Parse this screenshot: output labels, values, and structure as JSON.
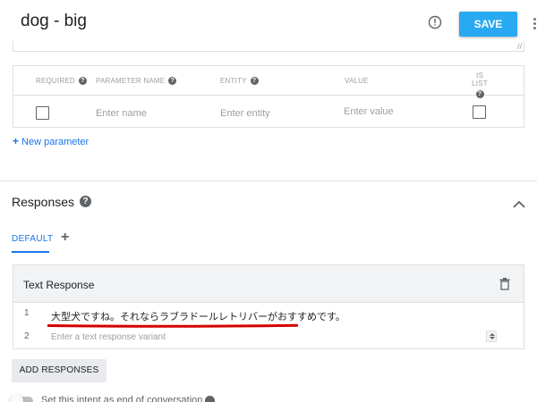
{
  "header": {
    "title": "dog - big",
    "save_label": "SAVE",
    "accent_color": "#29a9f2"
  },
  "parameters": {
    "columns": {
      "required": "REQUIRED",
      "parameter_name": "PARAMETER NAME",
      "entity": "ENTITY",
      "value": "VALUE",
      "is_list": "IS LIST"
    },
    "row": {
      "name_placeholder": "Enter name",
      "entity_placeholder": "Enter entity",
      "value_placeholder": "Enter value"
    },
    "new_parameter_label": "New parameter"
  },
  "responses": {
    "title": "Responses",
    "tabs": [
      {
        "label": "DEFAULT"
      }
    ],
    "text_response": {
      "title": "Text Response",
      "rows": [
        {
          "num": "1",
          "text": "大型犬ですね。それならラブラドールレトリバーがおすすめです。"
        },
        {
          "num": "2",
          "placeholder": "Enter a text response variant"
        }
      ]
    },
    "add_responses_label": "ADD RESPONSES",
    "end_conversation_label": "Set this intent as end of conversation"
  },
  "icons": [
    "info-icon",
    "more-vert-icon",
    "help-icon",
    "plus-icon",
    "chevron-up-icon",
    "trash-icon",
    "toggle-switch"
  ]
}
